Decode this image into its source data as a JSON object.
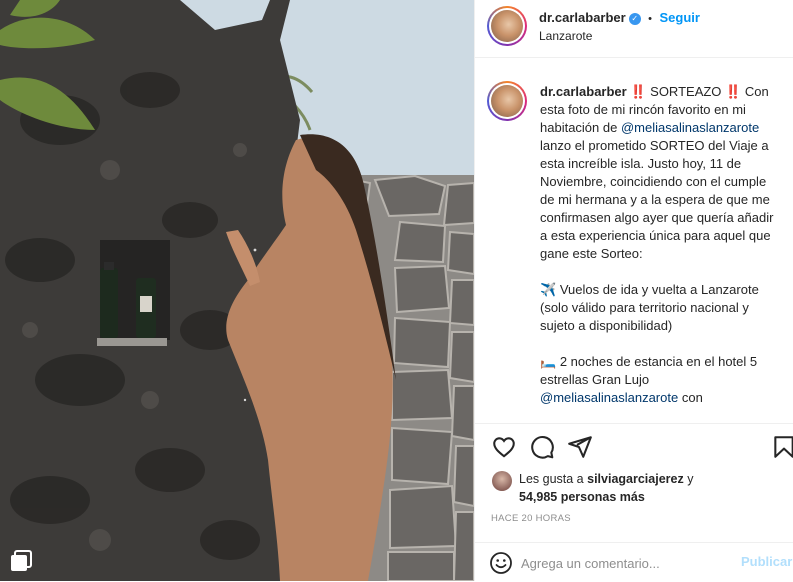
{
  "post": {
    "username": "dr.carlabarber",
    "verified_icon": "verified-badge-icon",
    "follow_separator": "•",
    "follow_label": "Seguir",
    "location": "Lanzarote"
  },
  "caption": {
    "username": "dr.carlabarber",
    "line1": "‼️ SORTEAZO ‼️",
    "line2_before": "Con esta foto de mi rincón favorito en mi habitación de",
    "mention1": "@meliasalinaslanzarote",
    "line2_after": "lanzo el prometido SORTEO del Viaje a esta increíble isla. Justo hoy, 11 de Noviembre, coincidiendo con el cumple de mi hermana y a la espera de que me confirmasen algo ayer que quería añadir a esta experiencia única para aquel que gane este Sorteo:",
    "item1_emoji": "✈️",
    "item1_text": "Vuelos de ida y vuelta a Lanzarote (solo válido para territorio nacional y sujeto a disponibilidad)",
    "item2_emoji": "🛏️",
    "item2_text": "2 noches de estancia en el hotel 5 estrellas Gran Lujo",
    "mention2": "@meliasalinaslanzarote",
    "item2_after": "con"
  },
  "actions": {
    "like_icon": "heart-icon",
    "comment_icon": "comment-icon",
    "share_icon": "share-icon",
    "save_icon": "bookmark-icon"
  },
  "likes": {
    "prefix": "Les gusta a",
    "user": "silviagarciajerez",
    "conj": "y",
    "count": "54,985 personas más"
  },
  "timestamp": "HACE 20 HORAS",
  "comment": {
    "emoji_icon": "emoji-smile-icon",
    "placeholder": "Agrega un comentario...",
    "post_label": "Publicar"
  },
  "colors": {
    "accent": "#0095f6",
    "verified": "#3897f0",
    "post_disabled": "#b2dffc",
    "mention": "#00376b"
  },
  "photo_indicator_icon": "multiple-posts-icon"
}
